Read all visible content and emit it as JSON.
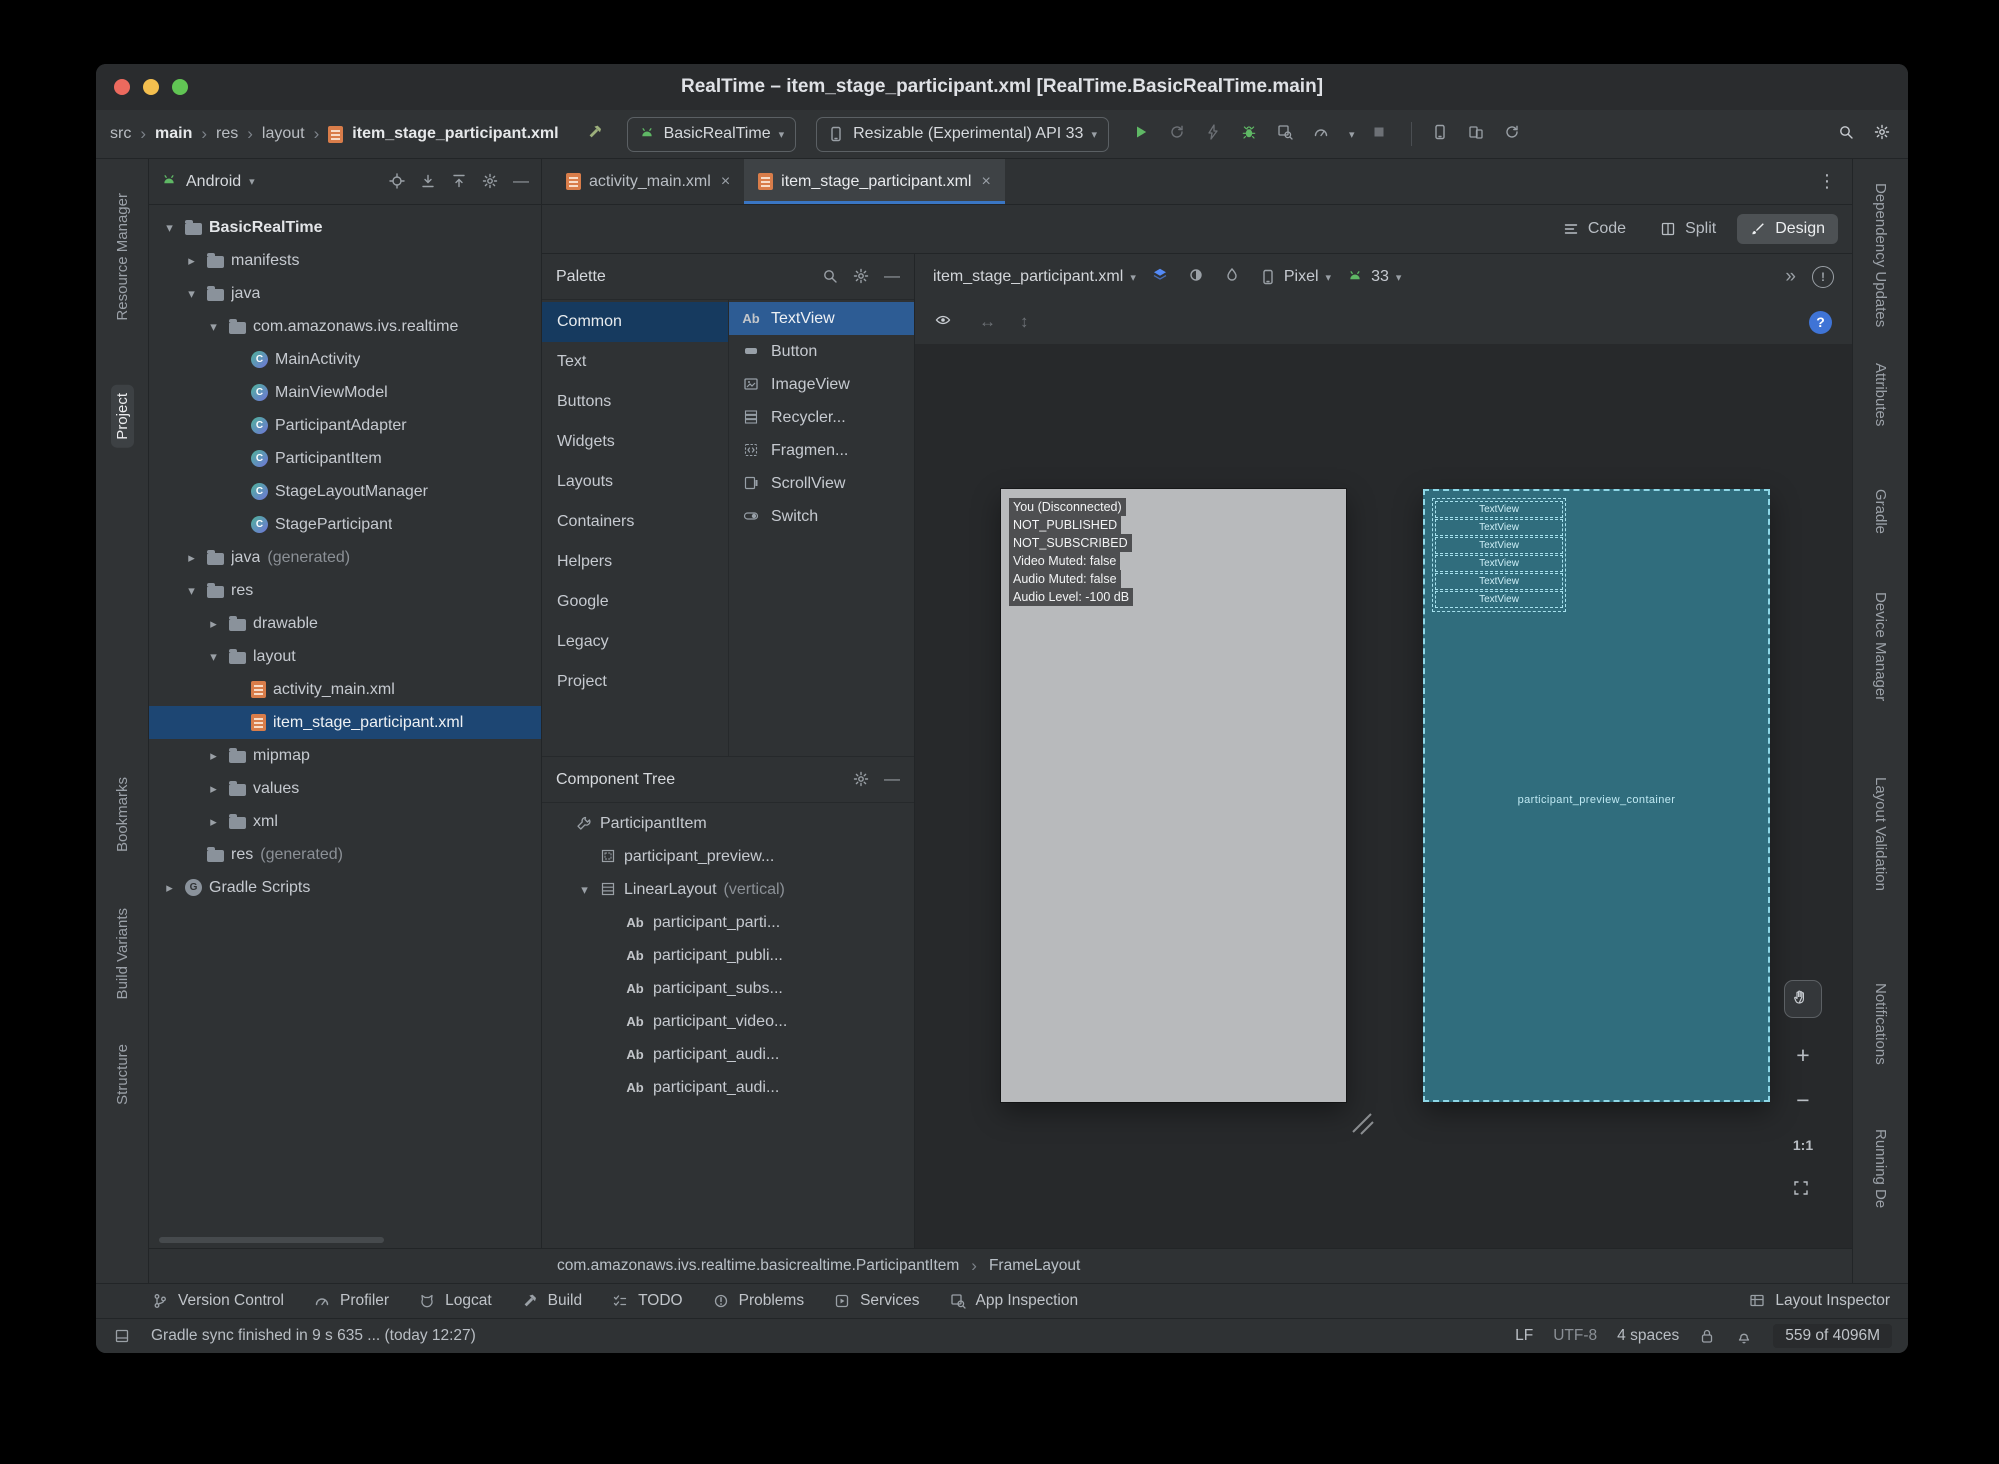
{
  "titlebar": {
    "title": "RealTime – item_stage_participant.xml [RealTime.BasicRealTime.main]"
  },
  "toolbar": {
    "breadcrumbs": [
      "src",
      "main",
      "res",
      "layout",
      "item_stage_participant.xml"
    ],
    "run_config": "BasicRealTime",
    "device": "Resizable (Experimental) API 33"
  },
  "left_strip": {
    "items": [
      "Resource Manager",
      "Project",
      "Bookmarks",
      "Build Variants",
      "Structure"
    ]
  },
  "right_strip": {
    "items": [
      "Dependency Updates",
      "Attributes",
      "Gradle",
      "Device Manager",
      "Layout Validation",
      "Notifications",
      "Running De"
    ]
  },
  "project_panel": {
    "view_selector": "Android",
    "tree": [
      {
        "label": "BasicRealTime"
      },
      {
        "label": "manifests"
      },
      {
        "label": "java"
      },
      {
        "label": "com.amazonaws.ivs.realtime"
      },
      {
        "label": "MainActivity"
      },
      {
        "label": "MainViewModel"
      },
      {
        "label": "ParticipantAdapter"
      },
      {
        "label": "ParticipantItem"
      },
      {
        "label": "StageLayoutManager"
      },
      {
        "label": "StageParticipant"
      },
      {
        "label": "java",
        "suffix": "(generated)"
      },
      {
        "label": "res"
      },
      {
        "label": "drawable"
      },
      {
        "label": "layout"
      },
      {
        "label": "activity_main.xml"
      },
      {
        "label": "item_stage_participant.xml"
      },
      {
        "label": "mipmap"
      },
      {
        "label": "values"
      },
      {
        "label": "xml"
      },
      {
        "label": "res",
        "suffix": "(generated)"
      },
      {
        "label": "Gradle Scripts"
      }
    ]
  },
  "tabs": {
    "items": [
      "activity_main.xml",
      "item_stage_participant.xml"
    ]
  },
  "modes": {
    "items": [
      "Code",
      "Split",
      "Design"
    ]
  },
  "palette": {
    "title": "Palette",
    "categories": [
      "Common",
      "Text",
      "Buttons",
      "Widgets",
      "Layouts",
      "Containers",
      "Helpers",
      "Google",
      "Legacy",
      "Project"
    ],
    "components": [
      "TextView",
      "Button",
      "ImageView",
      "Recycler...",
      "Fragmen...",
      "ScrollView",
      "Switch"
    ]
  },
  "component_tree": {
    "title": "Component Tree",
    "items": [
      {
        "label": "ParticipantItem"
      },
      {
        "label": "participant_preview..."
      },
      {
        "label": "LinearLayout",
        "suffix": "(vertical)"
      },
      {
        "label": "participant_parti..."
      },
      {
        "label": "participant_publi..."
      },
      {
        "label": "participant_subs..."
      },
      {
        "label": "participant_video..."
      },
      {
        "label": "participant_audi..."
      },
      {
        "label": "participant_audi..."
      }
    ]
  },
  "design_toolbar": {
    "file": "item_stage_participant.xml",
    "device": "Pixel",
    "api": "33"
  },
  "canvas": {
    "design_preview": {
      "lines": [
        "You (Disconnected)",
        "NOT_PUBLISHED",
        "NOT_SUBSCRIBED",
        "Video Muted: false",
        "Audio Muted: false",
        "Audio Level: -100 dB"
      ]
    },
    "blueprint": {
      "textviews": [
        "TextView",
        "TextView",
        "TextView",
        "TextView",
        "TextView",
        "TextView"
      ],
      "container_label": "participant_preview_container"
    },
    "zoom": {
      "zoom_in": "+",
      "zoom_out": "−",
      "one_to_one": "1:1"
    }
  },
  "editor_breadcrumb": {
    "items": [
      "com.amazonaws.ivs.realtime.basicrealtime.ParticipantItem",
      "FrameLayout"
    ]
  },
  "bottom_bar": {
    "left": [
      "Version Control",
      "Profiler",
      "Logcat",
      "Build",
      "TODO",
      "Problems",
      "Services",
      "App Inspection"
    ],
    "right": [
      "Layout Inspector"
    ]
  },
  "status_bar": {
    "message": "Gradle sync finished in 9 s 635 ... (today 12:27)",
    "line_ending": "LF",
    "encoding": "UTF-8",
    "indent": "4 spaces",
    "memory": "559 of 4096M"
  },
  "icons": {
    "caret": "▾",
    "chevron_down": "▾",
    "chevron_right": "▸",
    "crumb_sep": "›",
    "close": "×",
    "minus": "—",
    "overflow": "»",
    "more_vertical": "⋮",
    "h_arrow": "↔",
    "v_arrow": "↕",
    "question": "?",
    "bang": "!"
  },
  "colors": {
    "accent_blue": "#3a76c4",
    "run_green": "#5fb865",
    "xml_orange": "#d97d4a",
    "blueprint_teal": "#306d7d",
    "selection_blue": "#1d4673"
  }
}
